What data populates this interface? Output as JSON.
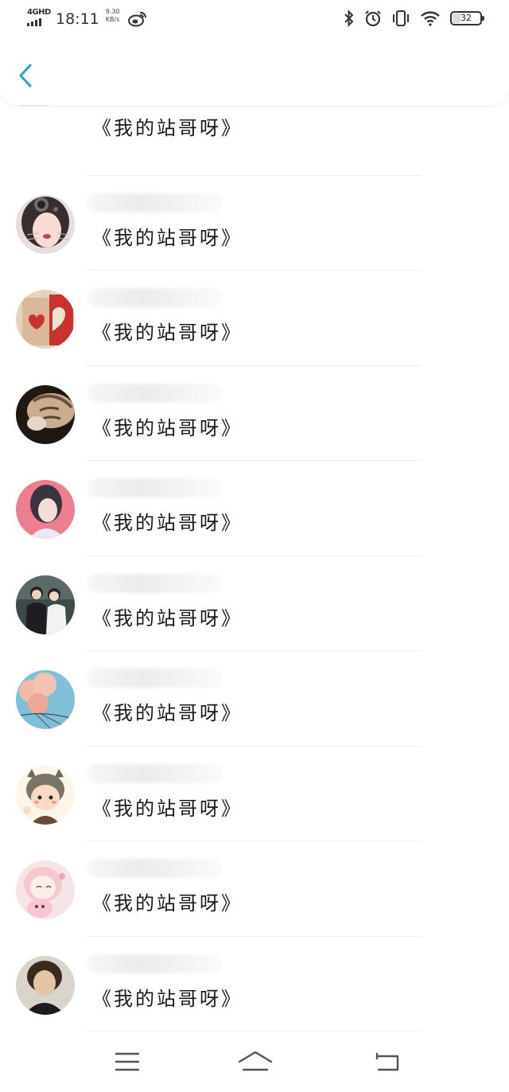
{
  "status_bar": {
    "network": "4GHD",
    "time": "18:11",
    "speed_value": "9.30",
    "speed_unit": "KB/s",
    "battery": "32",
    "battery_level_percent": 32
  },
  "header": {
    "back_icon": "chevron-left-icon",
    "accent_color": "#2a9fd8"
  },
  "list": {
    "items": [
      {
        "title": "《我的站哥呀》",
        "avatar": "blurred-avatar"
      },
      {
        "title": "《我的站哥呀》",
        "avatar": "girl-cat-filter-avatar"
      },
      {
        "title": "《我的站哥呀》",
        "avatar": "heart-box-avatar"
      },
      {
        "title": "《我的站哥呀》",
        "avatar": "cat-avatar"
      },
      {
        "title": "《我的站哥呀》",
        "avatar": "pink-girl-avatar"
      },
      {
        "title": "《我的站哥呀》",
        "avatar": "couple-avatar"
      },
      {
        "title": "《我的站哥呀》",
        "avatar": "balloon-sky-avatar"
      },
      {
        "title": "《我的站哥呀》",
        "avatar": "totoro-boy-avatar"
      },
      {
        "title": "《我的站哥呀》",
        "avatar": "pink-anime-avatar"
      },
      {
        "title": "《我的站哥呀》",
        "avatar": "curly-boy-avatar"
      }
    ]
  },
  "bottom_nav": {
    "menu_icon": "menu-icon",
    "home_icon": "home-icon",
    "back_icon": "return-icon"
  }
}
